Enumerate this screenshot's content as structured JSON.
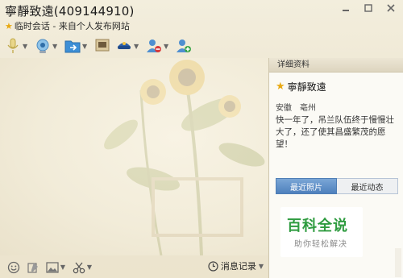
{
  "window": {
    "title": "寧靜致遠(409144910)",
    "subtitle": "临时会话 - 来自个人发布网站",
    "controls": [
      "minimize-icon",
      "maximize-icon",
      "close-icon"
    ]
  },
  "toolbar": {
    "items": [
      {
        "icon": "microphone-icon",
        "dropdown": true
      },
      {
        "icon": "webcam-icon",
        "dropdown": true
      },
      {
        "icon": "send-file-icon",
        "dropdown": true
      },
      {
        "icon": "remote-desktop-icon",
        "dropdown": false
      },
      {
        "icon": "app-share-icon",
        "dropdown": true
      },
      {
        "icon": "block-user-icon",
        "dropdown": true
      },
      {
        "icon": "add-friend-icon",
        "dropdown": false
      }
    ]
  },
  "bottombar": {
    "items": [
      "emoticon-icon",
      "font-icon",
      "picture-icon",
      "screenshot-icon"
    ],
    "history_label": "消息记录"
  },
  "panel": {
    "header": "详细资料",
    "name": "寧靜致遠",
    "province": "安徽",
    "city": "亳州",
    "signature": "快一年了，吊兰队伍终于慢慢壮大了，还了使其昌盛繁茂的愿望！",
    "tabs": [
      "最近照片",
      "最近动态"
    ],
    "active_tab": "最近照片"
  },
  "watermark": {
    "title": "百科全说",
    "subtitle": "助你轻松解决"
  },
  "colors": {
    "accent_tab": "#4e80bd",
    "watermark_green": "#2e9b3f",
    "star": "#e8a810"
  }
}
